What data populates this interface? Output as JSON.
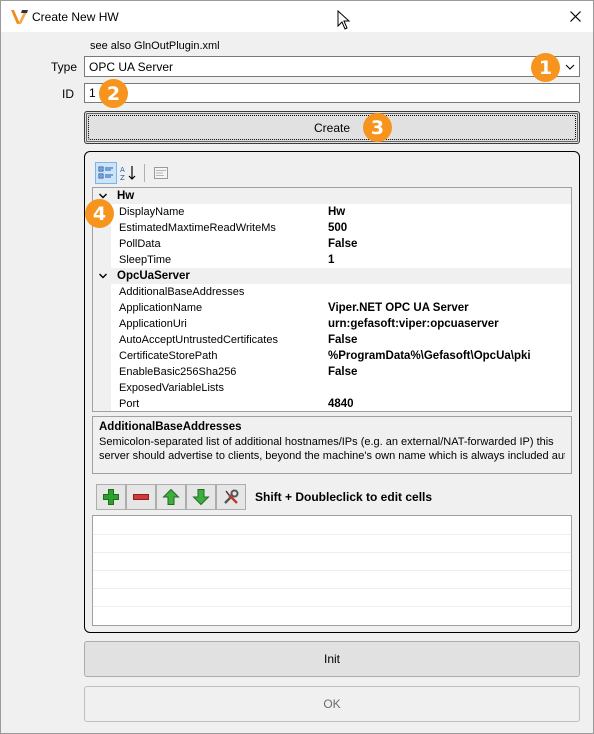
{
  "window": {
    "title": "Create New HW"
  },
  "hint": "see also GlnOutPlugin.xml",
  "type_field": {
    "label": "Type",
    "value": "OPC UA Server"
  },
  "id_field": {
    "label": "ID",
    "value": "1"
  },
  "buttons": {
    "create": "Create",
    "init": "Init",
    "ok": "OK"
  },
  "property_grid": {
    "categories": [
      {
        "name": "Hw",
        "rows": [
          {
            "name": "DisplayName",
            "value": "Hw"
          },
          {
            "name": "EstimatedMaxtimeReadWriteMs",
            "value": "500"
          },
          {
            "name": "PollData",
            "value": "False"
          },
          {
            "name": "SleepTime",
            "value": "1"
          }
        ]
      },
      {
        "name": "OpcUaServer",
        "rows": [
          {
            "name": "AdditionalBaseAddresses",
            "value": ""
          },
          {
            "name": "ApplicationName",
            "value": "Viper.NET OPC UA Server"
          },
          {
            "name": "ApplicationUri",
            "value": "urn:gefasoft:viper:opcuaserver"
          },
          {
            "name": "AutoAcceptUntrustedCertificates",
            "value": "False"
          },
          {
            "name": "CertificateStorePath",
            "value": "%ProgramData%\\Gefasoft\\OpcUa\\pki"
          },
          {
            "name": "EnableBasic256Sha256",
            "value": "False"
          },
          {
            "name": "ExposedVariableLists",
            "value": ""
          },
          {
            "name": "Port",
            "value": "4840"
          }
        ]
      }
    ],
    "help": {
      "title": "AdditionalBaseAddresses",
      "line1": "Semicolon-separated list of additional hostnames/IPs (e.g. an external/NAT-forwarded IP) this",
      "line2": "server should advertise to clients, beyond the machine's own name which is always included auto..."
    }
  },
  "list_hint": "Shift + Doubleclick to edit cells",
  "badges": [
    "1",
    "2",
    "3",
    "4"
  ],
  "colors": {
    "badge": "#f7941d",
    "add": "#2ea02e",
    "remove": "#d23a3a",
    "up_down": "#3fae3f"
  }
}
